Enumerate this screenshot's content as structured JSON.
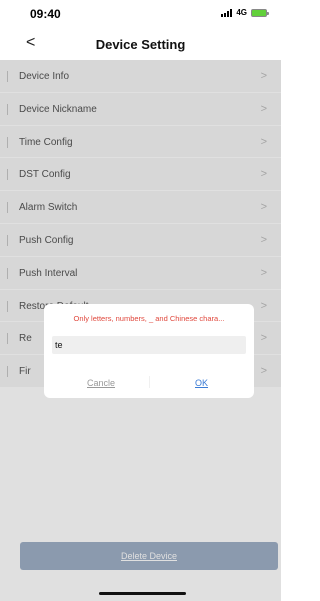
{
  "status_bar": {
    "time": "09:40",
    "network": "4G"
  },
  "nav": {
    "back_icon": "chevron-left-icon",
    "back_glyph": "<",
    "title": "Device Setting"
  },
  "menu": {
    "chevron_glyph": ">",
    "items": [
      {
        "label": "Device Info"
      },
      {
        "label": "Device Nickname"
      },
      {
        "label": "Time Config"
      },
      {
        "label": "DST Config"
      },
      {
        "label": "Alarm Switch"
      },
      {
        "label": "Push Config"
      },
      {
        "label": "Push Interval"
      },
      {
        "label": "Restore Default"
      },
      {
        "label": "Re"
      },
      {
        "label": "Fir"
      }
    ]
  },
  "dialog": {
    "message": "Only letters, numbers, _ and Chinese chara...",
    "input_value": "te",
    "cancel_label": "Cancle",
    "ok_label": "OK"
  },
  "footer": {
    "delete_label": "Delete Device"
  },
  "colors": {
    "error": "#e0473c",
    "link": "#3a7bd5",
    "delete_bg": "#9fb0c7",
    "battery": "#62d03a"
  }
}
